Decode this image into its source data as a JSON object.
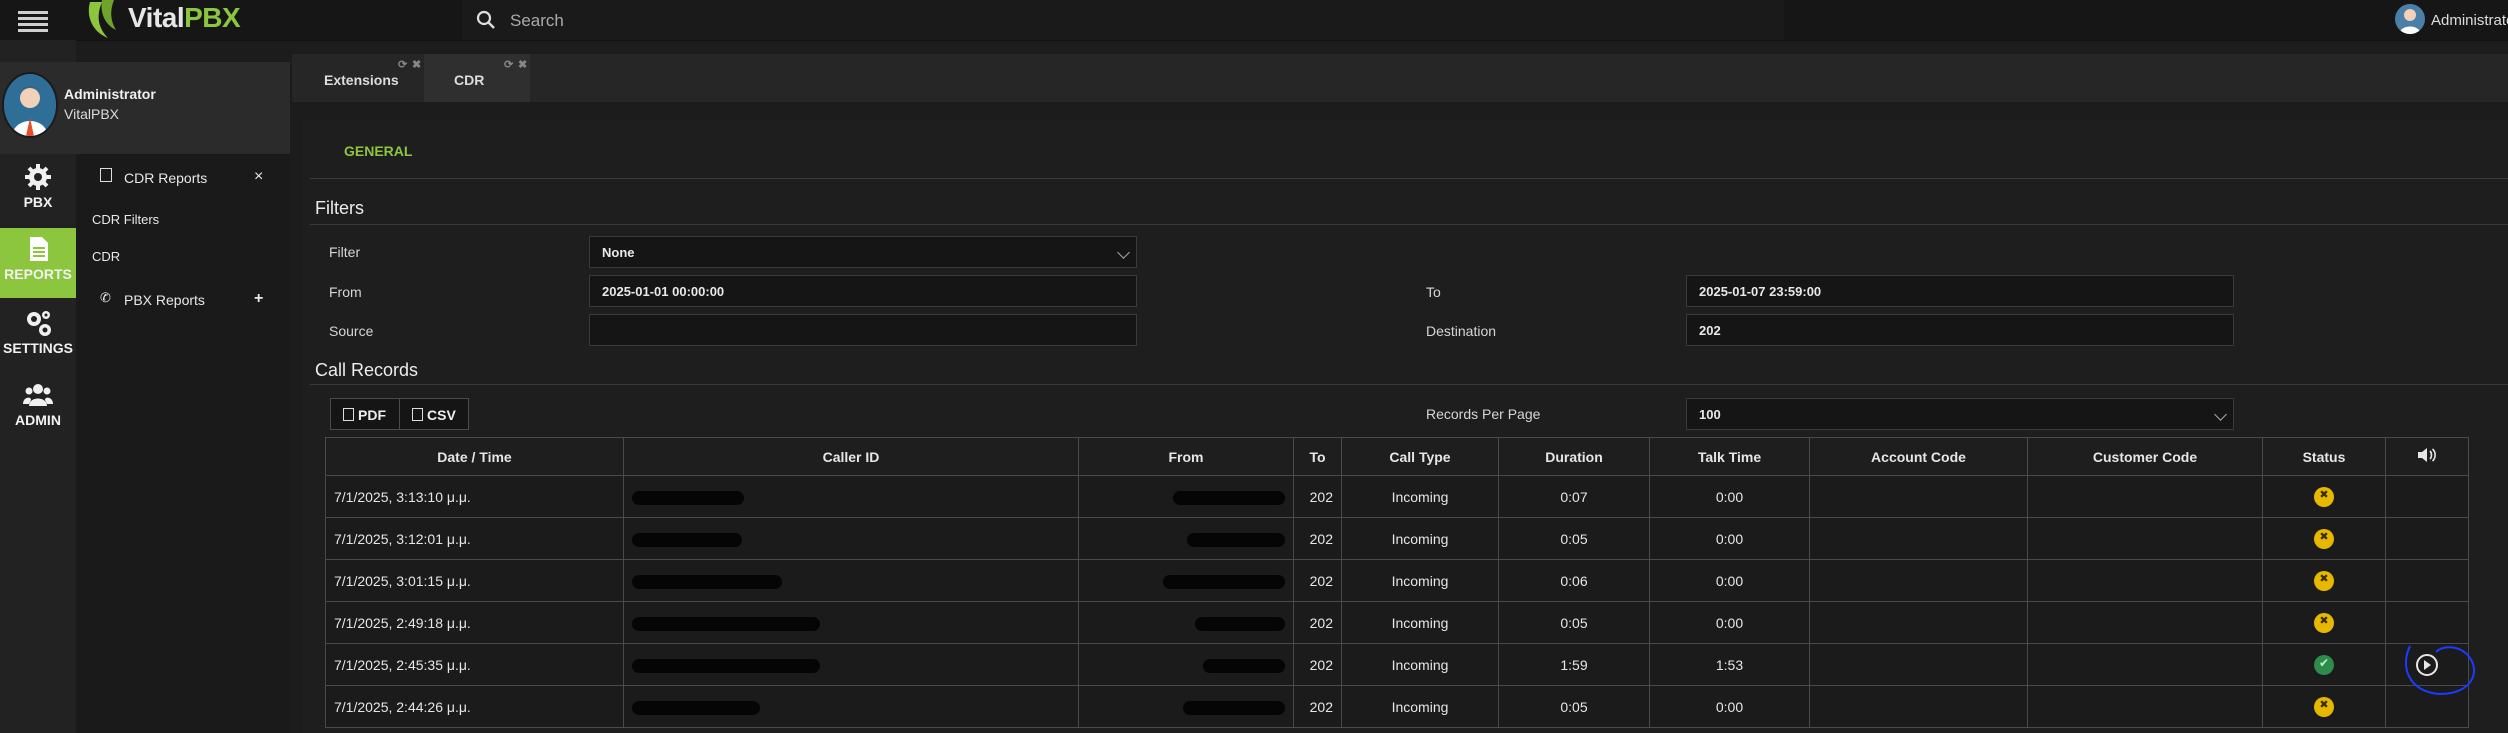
{
  "app": {
    "logo_vital": "Vital",
    "logo_pbx": "PBX",
    "search_placeholder": "Search",
    "top_user": "Administrator"
  },
  "profile": {
    "name": "Administrator",
    "sub": "VitalPBX"
  },
  "nav": [
    {
      "label": "PBX",
      "icon": "gear-icon"
    },
    {
      "label": "REPORTS",
      "icon": "document-icon"
    },
    {
      "label": "SETTINGS",
      "icon": "gears-icon"
    },
    {
      "label": "ADMIN",
      "icon": "users-icon"
    }
  ],
  "sidebar": {
    "cdr_reports": "CDR Reports",
    "close": "×",
    "cdr_filters": "CDR Filters",
    "cdr": "CDR",
    "pbx_reports": "PBX Reports",
    "expand": "+"
  },
  "tabs": [
    {
      "label": "Extensions"
    },
    {
      "label": "CDR"
    }
  ],
  "subtab": "GENERAL",
  "filters": {
    "title": "Filters",
    "filter_label": "Filter",
    "filter_value": "None",
    "from_label": "From",
    "from_value": "2025-01-01 00:00:00",
    "to_label": "To",
    "to_value": "2025-01-07 23:59:00",
    "source_label": "Source",
    "source_value": "",
    "destination_label": "Destination",
    "destination_value": "202"
  },
  "records": {
    "title": "Call Records",
    "pdf": "PDF",
    "csv": "CSV",
    "rpp_label": "Records Per Page",
    "rpp_value": "100"
  },
  "table": {
    "headers": [
      "Date / Time",
      "Caller ID",
      "From",
      "To",
      "Call Type",
      "Duration",
      "Talk Time",
      "Account Code",
      "Customer Code",
      "Status"
    ],
    "rows": [
      {
        "date": "7/1/2025, 3:13:10 μ.μ.",
        "to": "202",
        "type": "Incoming",
        "duration": "0:07",
        "talk": "0:00",
        "status": "unanswered"
      },
      {
        "date": "7/1/2025, 3:12:01 μ.μ.",
        "to": "202",
        "type": "Incoming",
        "duration": "0:05",
        "talk": "0:00",
        "status": "unanswered"
      },
      {
        "date": "7/1/2025, 3:01:15 μ.μ.",
        "to": "202",
        "type": "Incoming",
        "duration": "0:06",
        "talk": "0:00",
        "status": "unanswered"
      },
      {
        "date": "7/1/2025, 2:49:18 μ.μ.",
        "to": "202",
        "type": "Incoming",
        "duration": "0:05",
        "talk": "0:00",
        "status": "unanswered"
      },
      {
        "date": "7/1/2025, 2:45:35 μ.μ.",
        "to": "202",
        "type": "Incoming",
        "duration": "1:59",
        "talk": "1:53",
        "status": "answered"
      },
      {
        "date": "7/1/2025, 2:44:26 μ.μ.",
        "to": "202",
        "type": "Incoming",
        "duration": "0:05",
        "talk": "0:00",
        "status": "unanswered"
      }
    ]
  },
  "colors": {
    "accent": "#8cc63f",
    "warning": "#e6b800",
    "success": "#2e8b4a",
    "annotation": "#1a3cff"
  }
}
